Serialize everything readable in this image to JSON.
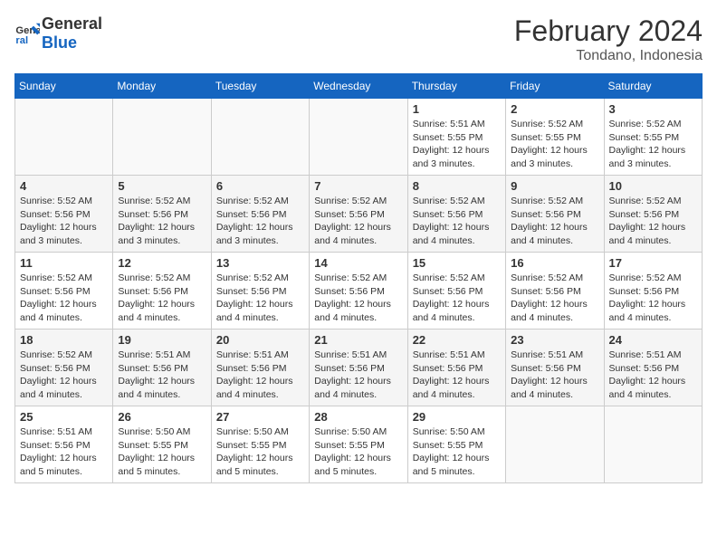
{
  "logo": {
    "line1": "General",
    "line2": "Blue"
  },
  "title": "February 2024",
  "subtitle": "Tondano, Indonesia",
  "days_of_week": [
    "Sunday",
    "Monday",
    "Tuesday",
    "Wednesday",
    "Thursday",
    "Friday",
    "Saturday"
  ],
  "weeks": [
    [
      {
        "day": "",
        "info": ""
      },
      {
        "day": "",
        "info": ""
      },
      {
        "day": "",
        "info": ""
      },
      {
        "day": "",
        "info": ""
      },
      {
        "day": "1",
        "info": "Sunrise: 5:51 AM\nSunset: 5:55 PM\nDaylight: 12 hours\nand 3 minutes."
      },
      {
        "day": "2",
        "info": "Sunrise: 5:52 AM\nSunset: 5:55 PM\nDaylight: 12 hours\nand 3 minutes."
      },
      {
        "day": "3",
        "info": "Sunrise: 5:52 AM\nSunset: 5:55 PM\nDaylight: 12 hours\nand 3 minutes."
      }
    ],
    [
      {
        "day": "4",
        "info": "Sunrise: 5:52 AM\nSunset: 5:56 PM\nDaylight: 12 hours\nand 3 minutes."
      },
      {
        "day": "5",
        "info": "Sunrise: 5:52 AM\nSunset: 5:56 PM\nDaylight: 12 hours\nand 3 minutes."
      },
      {
        "day": "6",
        "info": "Sunrise: 5:52 AM\nSunset: 5:56 PM\nDaylight: 12 hours\nand 3 minutes."
      },
      {
        "day": "7",
        "info": "Sunrise: 5:52 AM\nSunset: 5:56 PM\nDaylight: 12 hours\nand 4 minutes."
      },
      {
        "day": "8",
        "info": "Sunrise: 5:52 AM\nSunset: 5:56 PM\nDaylight: 12 hours\nand 4 minutes."
      },
      {
        "day": "9",
        "info": "Sunrise: 5:52 AM\nSunset: 5:56 PM\nDaylight: 12 hours\nand 4 minutes."
      },
      {
        "day": "10",
        "info": "Sunrise: 5:52 AM\nSunset: 5:56 PM\nDaylight: 12 hours\nand 4 minutes."
      }
    ],
    [
      {
        "day": "11",
        "info": "Sunrise: 5:52 AM\nSunset: 5:56 PM\nDaylight: 12 hours\nand 4 minutes."
      },
      {
        "day": "12",
        "info": "Sunrise: 5:52 AM\nSunset: 5:56 PM\nDaylight: 12 hours\nand 4 minutes."
      },
      {
        "day": "13",
        "info": "Sunrise: 5:52 AM\nSunset: 5:56 PM\nDaylight: 12 hours\nand 4 minutes."
      },
      {
        "day": "14",
        "info": "Sunrise: 5:52 AM\nSunset: 5:56 PM\nDaylight: 12 hours\nand 4 minutes."
      },
      {
        "day": "15",
        "info": "Sunrise: 5:52 AM\nSunset: 5:56 PM\nDaylight: 12 hours\nand 4 minutes."
      },
      {
        "day": "16",
        "info": "Sunrise: 5:52 AM\nSunset: 5:56 PM\nDaylight: 12 hours\nand 4 minutes."
      },
      {
        "day": "17",
        "info": "Sunrise: 5:52 AM\nSunset: 5:56 PM\nDaylight: 12 hours\nand 4 minutes."
      }
    ],
    [
      {
        "day": "18",
        "info": "Sunrise: 5:52 AM\nSunset: 5:56 PM\nDaylight: 12 hours\nand 4 minutes."
      },
      {
        "day": "19",
        "info": "Sunrise: 5:51 AM\nSunset: 5:56 PM\nDaylight: 12 hours\nand 4 minutes."
      },
      {
        "day": "20",
        "info": "Sunrise: 5:51 AM\nSunset: 5:56 PM\nDaylight: 12 hours\nand 4 minutes."
      },
      {
        "day": "21",
        "info": "Sunrise: 5:51 AM\nSunset: 5:56 PM\nDaylight: 12 hours\nand 4 minutes."
      },
      {
        "day": "22",
        "info": "Sunrise: 5:51 AM\nSunset: 5:56 PM\nDaylight: 12 hours\nand 4 minutes."
      },
      {
        "day": "23",
        "info": "Sunrise: 5:51 AM\nSunset: 5:56 PM\nDaylight: 12 hours\nand 4 minutes."
      },
      {
        "day": "24",
        "info": "Sunrise: 5:51 AM\nSunset: 5:56 PM\nDaylight: 12 hours\nand 4 minutes."
      }
    ],
    [
      {
        "day": "25",
        "info": "Sunrise: 5:51 AM\nSunset: 5:56 PM\nDaylight: 12 hours\nand 5 minutes."
      },
      {
        "day": "26",
        "info": "Sunrise: 5:50 AM\nSunset: 5:55 PM\nDaylight: 12 hours\nand 5 minutes."
      },
      {
        "day": "27",
        "info": "Sunrise: 5:50 AM\nSunset: 5:55 PM\nDaylight: 12 hours\nand 5 minutes."
      },
      {
        "day": "28",
        "info": "Sunrise: 5:50 AM\nSunset: 5:55 PM\nDaylight: 12 hours\nand 5 minutes."
      },
      {
        "day": "29",
        "info": "Sunrise: 5:50 AM\nSunset: 5:55 PM\nDaylight: 12 hours\nand 5 minutes."
      },
      {
        "day": "",
        "info": ""
      },
      {
        "day": "",
        "info": ""
      }
    ]
  ]
}
